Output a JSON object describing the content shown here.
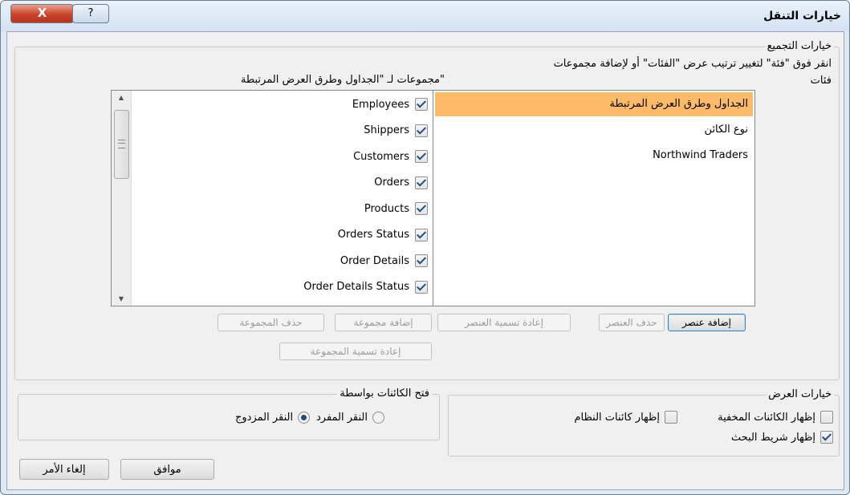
{
  "window": {
    "title": "خيارات التنقل",
    "close_glyph": "X",
    "help_glyph": "?"
  },
  "grouping": {
    "legend": "خيارات التجميع",
    "instruction": "انقر فوق \"فئة\" لتغيير ترتيب عرض \"الفئات\" أو لإضافة مجموعات",
    "categories_label": "فئات",
    "groups_label": "مجموعات لـ \"الجداول وطرق العرض المرتبطة\"",
    "categories": [
      "الجداول وطرق العرض المرتبطة",
      "نوع الكائن",
      "Northwind Traders"
    ],
    "groups": [
      {
        "label": "Employees",
        "checked": true
      },
      {
        "label": "Shippers",
        "checked": true
      },
      {
        "label": "Customers",
        "checked": true
      },
      {
        "label": "Orders",
        "checked": true
      },
      {
        "label": "Products",
        "checked": true
      },
      {
        "label": "Orders Status",
        "checked": true
      },
      {
        "label": "Order Details",
        "checked": true
      },
      {
        "label": "Order Details Status",
        "checked": true
      }
    ],
    "buttons": {
      "add_item": "إضافة عنصر",
      "delete_item": "حذف العنصر",
      "rename_item": "إعادة تسمية العنصر",
      "add_group": "إضافة مجموعة",
      "delete_group": "حذف المجموعة",
      "rename_group": "إعادة تسمية المجموعة"
    }
  },
  "display": {
    "legend": "خيارات العرض",
    "show_hidden": "إظهار الكائنات المخفية",
    "show_system": "إظهار كائنات النظام",
    "show_search": "إظهار شريط البحث",
    "show_hidden_checked": false,
    "show_system_checked": false,
    "show_search_checked": true
  },
  "open_objects": {
    "legend": "فتح الكائنات بواسطة",
    "single_click": "النقر المفرد",
    "double_click": "النقر المزدوج",
    "selected": "double"
  },
  "footer": {
    "ok": "موافق",
    "cancel": "إلغاء الأمر"
  },
  "colors": {
    "selection": "#fdbb68",
    "close": "#c8432a",
    "titlebar": "#dde9f5"
  }
}
